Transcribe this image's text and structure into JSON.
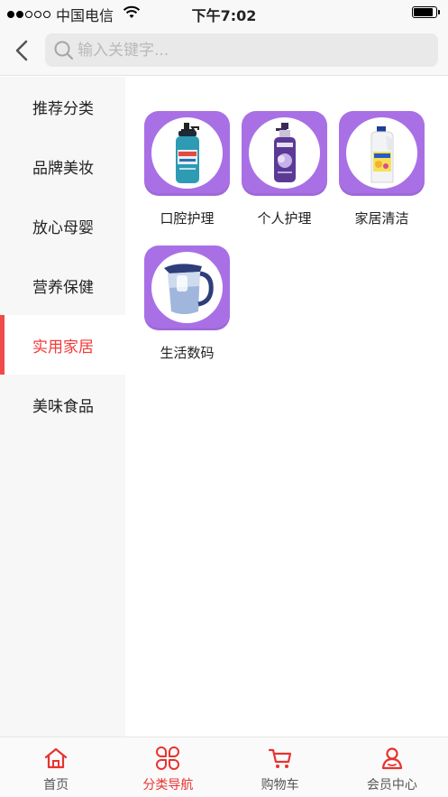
{
  "status_bar": {
    "carrier": "中国电信",
    "time": "下午7:02",
    "signal_bars_filled": 2,
    "battery_level": 0.8
  },
  "header": {
    "back_icon": "chevron-left-icon",
    "search": {
      "icon": "search-icon",
      "placeholder": "输入关键字..."
    }
  },
  "sidebar": {
    "items": [
      {
        "label": "推荐分类",
        "active": false
      },
      {
        "label": "品牌美妆",
        "active": false
      },
      {
        "label": "放心母婴",
        "active": false
      },
      {
        "label": "营养保健",
        "active": false
      },
      {
        "label": "实用家居",
        "active": true
      },
      {
        "label": "美味食品",
        "active": false
      }
    ]
  },
  "categories": [
    {
      "label": "口腔护理",
      "image": "toothpaste-product-image"
    },
    {
      "label": "个人护理",
      "image": "body-wash-product-image"
    },
    {
      "label": "家居清洁",
      "image": "detergent-bottle-image"
    },
    {
      "label": "生活数码",
      "image": "water-pitcher-image"
    }
  ],
  "tabbar": {
    "items": [
      {
        "label": "首页",
        "icon": "home-icon",
        "active": false
      },
      {
        "label": "分类导航",
        "icon": "category-icon",
        "active": true
      },
      {
        "label": "购物车",
        "icon": "cart-icon",
        "active": false
      },
      {
        "label": "会员中心",
        "icon": "user-icon",
        "active": false
      }
    ]
  },
  "colors": {
    "accent": "#e8332f",
    "category_tile": "#a970e6",
    "sidebar_bg": "#f7f7f7"
  }
}
